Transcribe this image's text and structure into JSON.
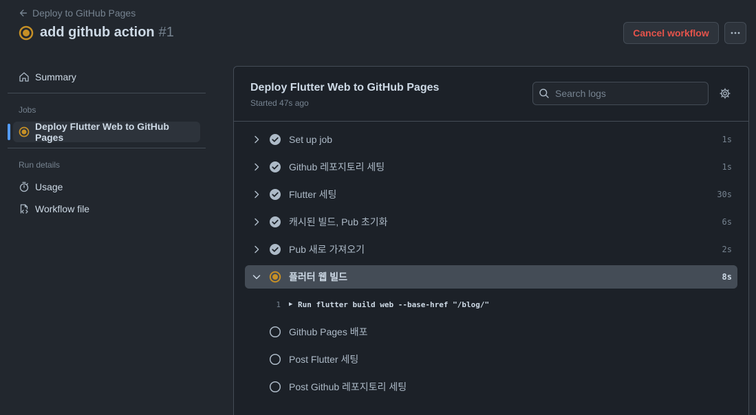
{
  "header": {
    "back_label": "Deploy to GitHub Pages",
    "run_title": "add github action",
    "run_number": "#1",
    "cancel_label": "Cancel workflow"
  },
  "sidebar": {
    "summary_label": "Summary",
    "jobs_heading": "Jobs",
    "active_job_label": "Deploy Flutter Web to GitHub Pages",
    "run_details_heading": "Run details",
    "usage_label": "Usage",
    "workflow_file_label": "Workflow file"
  },
  "job": {
    "title": "Deploy Flutter Web to GitHub Pages",
    "started": "Started 47s ago",
    "search_placeholder": "Search logs",
    "steps": [
      {
        "name": "Set up job",
        "duration": "1s",
        "status": "success"
      },
      {
        "name": "Github 레포지토리 세팅",
        "duration": "1s",
        "status": "success"
      },
      {
        "name": "Flutter 세팅",
        "duration": "30s",
        "status": "success"
      },
      {
        "name": "캐시된 빌드, Pub 초기화",
        "duration": "6s",
        "status": "success"
      },
      {
        "name": "Pub 새로 가져오기",
        "duration": "2s",
        "status": "success"
      },
      {
        "name": "플러터 웹 빌드",
        "duration": "8s",
        "status": "in_progress"
      },
      {
        "name": "Github Pages 배포",
        "duration": "",
        "status": "queued"
      },
      {
        "name": "Post Flutter 세팅",
        "duration": "",
        "status": "queued"
      },
      {
        "name": "Post Github 레포지토리 세팅",
        "duration": "",
        "status": "queued"
      }
    ],
    "log": {
      "line_number": "1",
      "text": "Run flutter build web --base-href \"/blog/\""
    }
  },
  "colors": {
    "accent_blue": "#539bf5",
    "in_progress": "#c69026",
    "danger": "#e5534b",
    "success_icon": "#adbac7"
  }
}
